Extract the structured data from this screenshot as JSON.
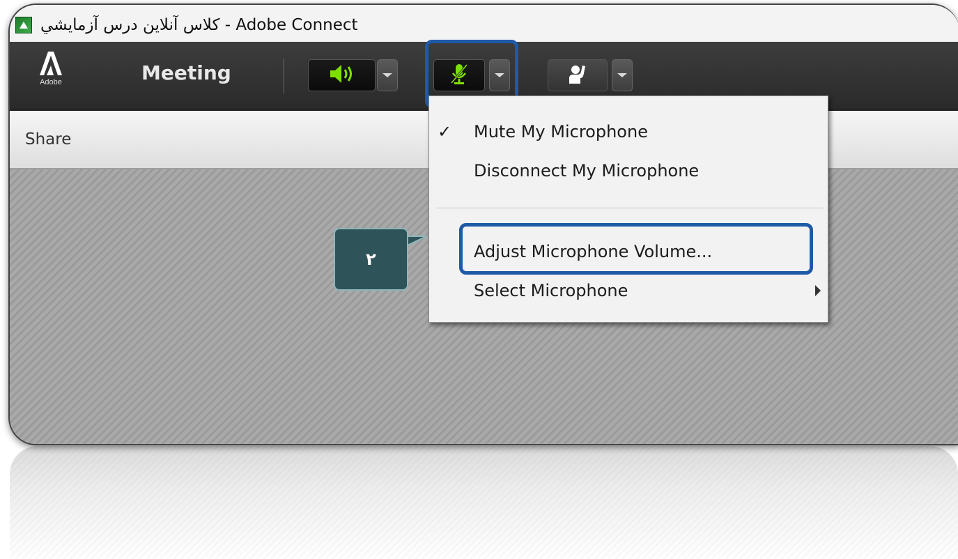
{
  "window": {
    "title": "كلاس آنلاين درس آزمايشي - Adobe Connect"
  },
  "toolbar": {
    "logo_label": "Adobe",
    "meeting_menu": "Meeting"
  },
  "pod": {
    "title": "Share"
  },
  "microphone_menu": {
    "items": [
      {
        "label": "Mute My Microphone",
        "checked": true
      },
      {
        "label": "Disconnect My Microphone",
        "checked": false
      },
      {
        "label": "Adjust Microphone Volume...",
        "checked": false,
        "highlighted": true
      },
      {
        "label": "Select Microphone",
        "checked": false,
        "submenu": true
      }
    ],
    "check_glyph": "✓"
  },
  "callout": {
    "number": "۲"
  },
  "colors": {
    "accent_highlight": "#1f5aa6",
    "audio_green": "#7ee000",
    "callout_bg": "#2e5358"
  },
  "icons": {
    "speaker": "speaker-volume-icon",
    "microphone": "microphone-muted-icon",
    "raise_hand": "raise-hand-icon"
  }
}
